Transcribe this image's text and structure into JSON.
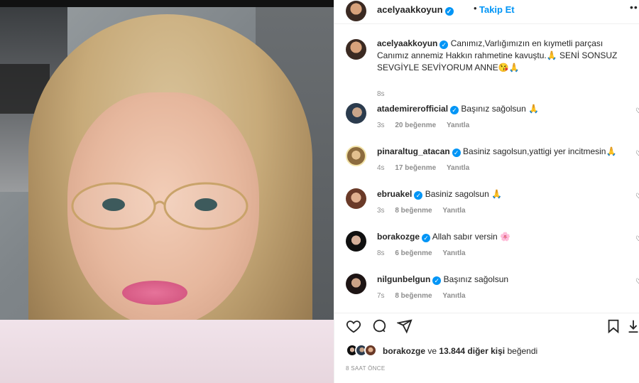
{
  "post": {
    "author": "acelyaakkoyun",
    "follow_label": "Takip Et",
    "separator": "•",
    "more_icon": "more-horizontal-icon",
    "caption_user": "acelyaakkoyun",
    "caption": "Canımız,Varlığımızın en kıymetli parçası Canımız annemiz Hakkın rahmetine kavuştu.🙏 SENİ SONSUZ SEVGİYLE SEVİYORUM ANNE😘🙏",
    "caption_age": "8s"
  },
  "comments": [
    {
      "user": "atademirerofficial",
      "text": "Başınız sağolsun 🙏",
      "age": "3s",
      "likes": "20 beğenme",
      "reply": "Yanıtla"
    },
    {
      "user": "pinaraltug_atacan",
      "text": "Basiniz sagolsun,yattigi yer incitmesin🙏",
      "age": "4s",
      "likes": "17 beğenme",
      "reply": "Yanıtla"
    },
    {
      "user": "ebruakel",
      "text": "Basiniz sagolsun 🙏",
      "age": "3s",
      "likes": "8 beğenme",
      "reply": "Yanıtla"
    },
    {
      "user": "borakozge",
      "text": "Allah sabır versin 🌸",
      "age": "8s",
      "likes": "6 beğenme",
      "reply": "Yanıtla"
    },
    {
      "user": "nilgunbelgun",
      "text": "Başınız sağolsun",
      "age": "7s",
      "likes": "8 beğenme",
      "reply": "Yanıtla"
    }
  ],
  "actions": {
    "like_icon": "heart-icon",
    "comment_icon": "comment-icon",
    "share_icon": "send-icon",
    "save_icon": "bookmark-icon"
  },
  "likes": {
    "user": "borakozge",
    "connector": "ve",
    "count": "13.844 diğer kişi",
    "suffix": "beğendi"
  },
  "time_ago": "8 SAAT ÖNCE",
  "colors": {
    "accent": "#0095f6",
    "text": "#262626",
    "muted": "#8e8e8e",
    "border": "#efefef"
  }
}
